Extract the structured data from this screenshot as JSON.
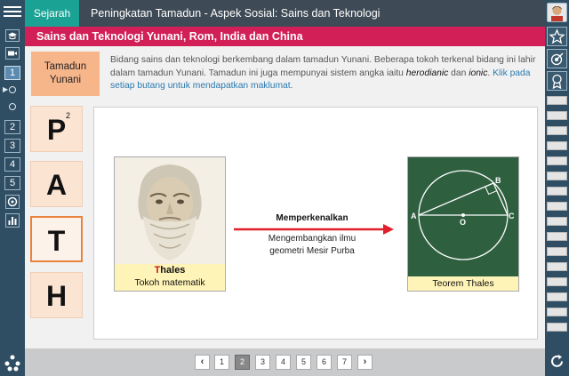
{
  "topbar": {
    "subject": "Sejarah",
    "title": "Peningkatan Tamadun - Aspek Sosial: Sains dan Teknologi"
  },
  "header": {
    "title": "Sains dan Teknologi Yunani, Rom, India dan China"
  },
  "intro": {
    "label": "Tamadun Yunani",
    "text_plain": "Bidang sains dan teknologi berkembang dalam tamadun Yunani. Beberapa tokoh terkenal bidang ini lahir dalam tamadun Yunani. Tamadun ini juga mempunyai sistem angka iaitu ",
    "term1": "herodianic",
    "conj": " dan ",
    "term2": "ionic",
    "period": ".",
    "instruction": "Klik pada setiap butang untuk mendapatkan maklumat."
  },
  "letters": [
    {
      "letter": "P",
      "sup": "2"
    },
    {
      "letter": "A"
    },
    {
      "letter": "T"
    },
    {
      "letter": "H"
    }
  ],
  "figure": {
    "name_first": "T",
    "name_rest": "hales",
    "caption": "Tokoh matematik",
    "arrow_label": "Memperkenalkan",
    "arrow_desc_1": "Mengembangkan ilmu",
    "arrow_desc_2": "geometri Mesir Purba",
    "diagram_labels": {
      "a": "A",
      "b": "B",
      "c": "C",
      "o": "O"
    },
    "diagram_caption": "Teorem Thales"
  },
  "left_rail": {
    "numbers": [
      "1",
      "2",
      "3",
      "4",
      "5"
    ]
  },
  "pager": {
    "prev": "‹",
    "next": "›",
    "pages": [
      "1",
      "2",
      "3",
      "4",
      "5",
      "6",
      "7"
    ],
    "current": "2"
  },
  "colors": {
    "accent": "#d21f57",
    "subject": "#1aa394",
    "rail": "#2f4d63",
    "arrow": "#e0202a"
  }
}
